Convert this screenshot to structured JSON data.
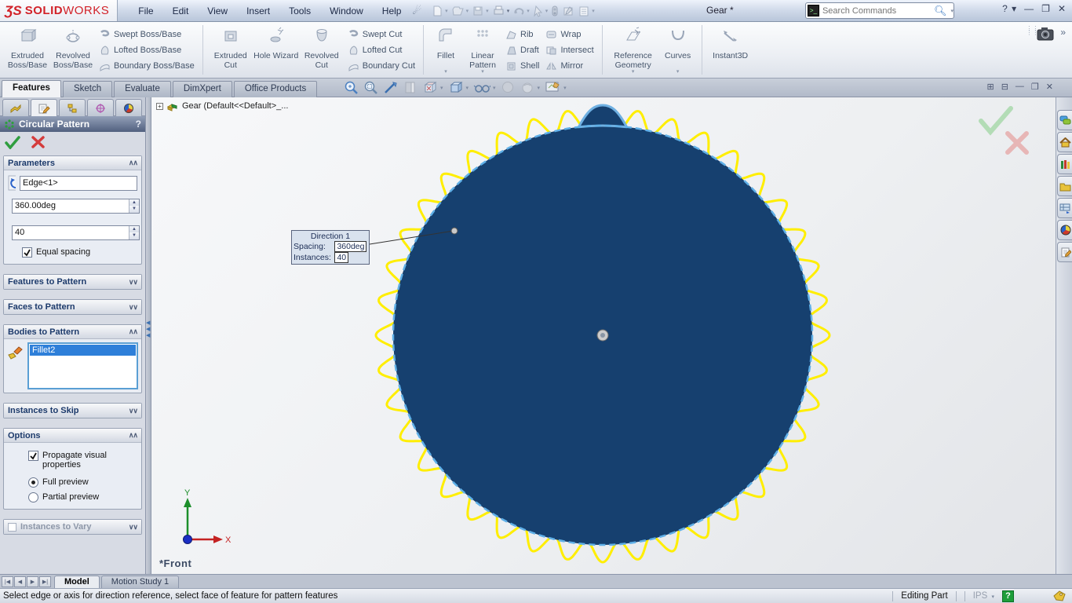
{
  "titlebar": {
    "logo_mark": "ƷS",
    "logo_solid": "SOLID",
    "logo_works": "WORKS",
    "menus": [
      "File",
      "Edit",
      "View",
      "Insert",
      "Tools",
      "Window",
      "Help"
    ],
    "title": "Gear *",
    "search_placeholder": "Search Commands",
    "minimize_glyph": "—",
    "restore_glyph": "❐",
    "close_glyph": "✕",
    "help_glyph": "?"
  },
  "ribbon": {
    "groups": [
      {
        "big": [
          {
            "label": "Extruded Boss/Base"
          },
          {
            "label": "Revolved Boss/Base"
          }
        ],
        "small": [
          {
            "label": "Swept Boss/Base"
          },
          {
            "label": "Lofted Boss/Base"
          },
          {
            "label": "Boundary Boss/Base"
          }
        ]
      },
      {
        "big": [
          {
            "label": "Extruded Cut"
          },
          {
            "label": "Hole Wizard"
          },
          {
            "label": "Revolved Cut"
          }
        ],
        "small": [
          {
            "label": "Swept Cut"
          },
          {
            "label": "Lofted Cut"
          },
          {
            "label": "Boundary Cut"
          }
        ]
      },
      {
        "big": [
          {
            "label": "Fillet"
          },
          {
            "label": "Linear Pattern"
          }
        ],
        "small_col1": [
          {
            "label": "Rib"
          },
          {
            "label": "Draft"
          },
          {
            "label": "Shell"
          }
        ],
        "small_col2": [
          {
            "label": "Wrap"
          },
          {
            "label": "Intersect"
          },
          {
            "label": "Mirror"
          }
        ]
      },
      {
        "big": [
          {
            "label": "Reference Geometry"
          },
          {
            "label": "Curves"
          }
        ]
      },
      {
        "big": [
          {
            "label": "Instant3D"
          }
        ]
      }
    ]
  },
  "tab_bar": {
    "tabs": [
      {
        "label": "Features"
      },
      {
        "label": "Sketch"
      },
      {
        "label": "Evaluate"
      },
      {
        "label": "DimXpert"
      },
      {
        "label": "Office Products"
      }
    ]
  },
  "property_manager": {
    "title": "Circular Pattern",
    "help_glyph": "?",
    "parameters": {
      "header": "Parameters",
      "axis_value": "Edge<1>",
      "angle_value": "360.00deg",
      "count_value": "40",
      "equal_spacing_label": "Equal spacing"
    },
    "features_to_pattern_header": "Features to Pattern",
    "faces_to_pattern_header": "Faces to Pattern",
    "bodies_to_pattern": {
      "header": "Bodies to Pattern",
      "selected_item": "Fillet2"
    },
    "instances_to_skip_header": "Instances to Skip",
    "options": {
      "header": "Options",
      "propagate_label": "Propagate visual properties",
      "full_preview_label": "Full preview",
      "partial_preview_label": "Partial preview"
    },
    "instances_to_vary_header": "Instances to Vary"
  },
  "viewport": {
    "feature_tree_label": "Gear  (Default<<Default>_...",
    "callout": {
      "title": "Direction 1",
      "spacing_label": "Spacing:",
      "spacing_value": "360deg",
      "instances_label": "Instances:",
      "instances_value": "40"
    },
    "orientation_label": "*Front",
    "triad": {
      "x_label": "X",
      "y_label": "Y"
    }
  },
  "bottom_bar": {
    "model_tab": "Model",
    "motion_tab": "Motion Study 1"
  },
  "status_bar": {
    "message": "Select edge or axis for direction reference, select face of feature for pattern features",
    "mode": "Editing Part",
    "units": "IPS"
  },
  "colors": {
    "gear_body": "#16406f",
    "tooth_preview": "#ffee00",
    "selected_edge": "#5fb0e8",
    "brand_red": "#d22128",
    "accept_green": "#2f9e3f",
    "cancel_red": "#d43c3c"
  }
}
